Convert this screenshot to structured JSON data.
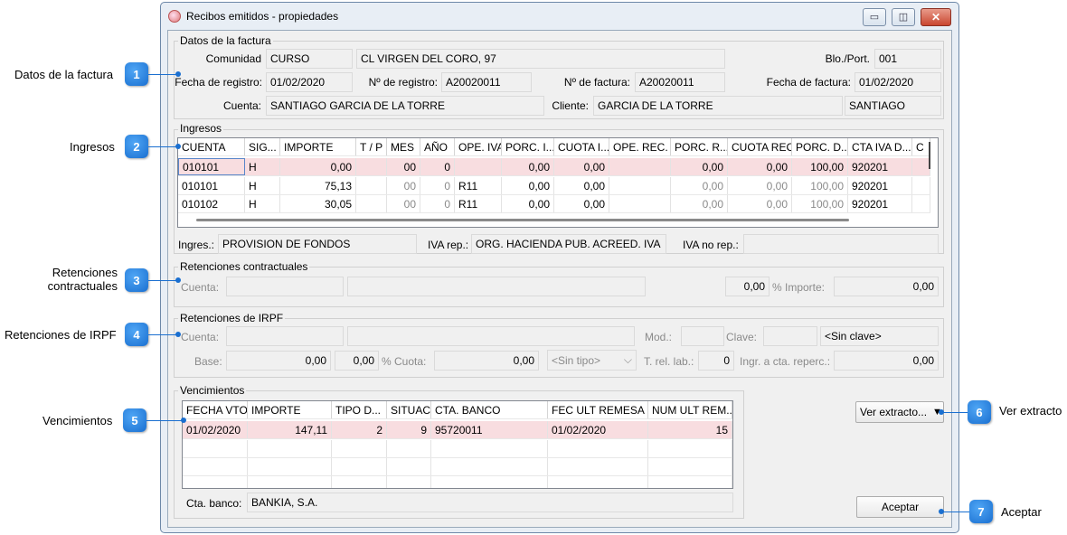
{
  "window": {
    "title": "Recibos emitidos - propiedades"
  },
  "callouts": [
    {
      "num": "1",
      "label": "Datos de la factura"
    },
    {
      "num": "2",
      "label": "Ingresos"
    },
    {
      "num": "3",
      "label_line1": "Retenciones",
      "label_line2": "contractuales"
    },
    {
      "num": "4",
      "label": "Retenciones de IRPF"
    },
    {
      "num": "5",
      "label": "Vencimientos"
    },
    {
      "num": "6",
      "label": "Ver extracto"
    },
    {
      "num": "7",
      "label": "Aceptar"
    }
  ],
  "factura": {
    "group_title": "Datos de la factura",
    "comunidad_label": "Comunidad",
    "comunidad_code": "CURSO",
    "comunidad_name": "CL VIRGEN DEL CORO, 97",
    "blo_label": "Blo./Port.",
    "blo_value": "001",
    "fecha_registro_label": "Fecha de registro:",
    "fecha_registro": "01/02/2020",
    "num_registro_label": "Nº de registro:",
    "num_registro": "A20020011",
    "num_factura_label": "Nº de factura:",
    "num_factura": "A20020011",
    "fecha_factura_label": "Fecha de factura:",
    "fecha_factura": "01/02/2020",
    "cuenta_label": "Cuenta:",
    "cuenta": "SANTIAGO GARCIA DE LA TORRE",
    "cliente_label": "Cliente:",
    "cliente": "GARCIA DE LA TORRE",
    "cliente_extra": "SANTIAGO"
  },
  "ingresos": {
    "group_title": "Ingresos",
    "columns": [
      "CUENTA",
      "SIG...",
      "IMPORTE",
      "T / P",
      "MES",
      "AÑO",
      "OPE. IVA",
      "PORC. I...",
      "CUOTA I...",
      "OPE. REC.",
      "PORC. R...",
      "CUOTA REC.",
      "PORC. D...",
      "CTA IVA D...",
      "C"
    ],
    "rows": [
      [
        "010101",
        "H",
        "0,00",
        "",
        "00",
        "0",
        "",
        "0,00",
        "0,00",
        "",
        "0,00",
        "0,00",
        "100,00",
        "920201",
        ""
      ],
      [
        "010101",
        "H",
        "75,13",
        "",
        "00",
        "0",
        "R11",
        "0,00",
        "0,00",
        "",
        "0,00",
        "0,00",
        "100,00",
        "920201",
        ""
      ],
      [
        "010102",
        "H",
        "30,05",
        "",
        "00",
        "0",
        "R11",
        "0,00",
        "0,00",
        "",
        "0,00",
        "0,00",
        "100,00",
        "920201",
        ""
      ]
    ],
    "ingres_label": "Ingres.:",
    "ingres_value": "PROVISION DE FONDOS",
    "iva_rep_label": "IVA rep.:",
    "iva_rep_value": "ORG. HACIENDA PUB. ACREED. IVA",
    "iva_norep_label": "IVA no rep.:",
    "iva_norep_value": ""
  },
  "ret_contractuales": {
    "group_title": "Retenciones contractuales",
    "cuenta_label": "Cuenta:",
    "value": "0,00",
    "pct_label": "% Importe:",
    "importe": "0,00"
  },
  "ret_irpf": {
    "group_title": "Retenciones de IRPF",
    "cuenta_label": "Cuenta:",
    "mod_label": "Mod.:",
    "clave_label": "Clave:",
    "clave_value": "<Sin clave>",
    "base_label": "Base:",
    "base_value": "0,00",
    "pct_value": "0,00",
    "cuota_label": "% Cuota:",
    "cuota_value": "0,00",
    "tipo_value": "<Sin tipo>",
    "trel_label": "T. rel. lab.:",
    "trel_value": "0",
    "ingr_label": "Ingr. a cta. reperc.:",
    "ingr_value": "0,00"
  },
  "vencimientos": {
    "group_title": "Vencimientos",
    "columns": [
      "FECHA VTO",
      "IMPORTE",
      "TIPO D...",
      "SITUAC...",
      "CTA. BANCO",
      "FEC ULT REMESA",
      "NUM ULT REM..."
    ],
    "rows": [
      [
        "01/02/2020",
        "147,11",
        "2",
        "9",
        "95720011",
        "01/02/2020",
        "15"
      ]
    ],
    "cta_banco_label": "Cta. banco:",
    "cta_banco_value": "BANKIA, S.A."
  },
  "buttons": {
    "ver_extracto": "Ver extracto...",
    "aceptar": "Aceptar"
  },
  "colors": {
    "selected_row": "#f8dde0",
    "callout_blue": "#1a6fd0"
  }
}
